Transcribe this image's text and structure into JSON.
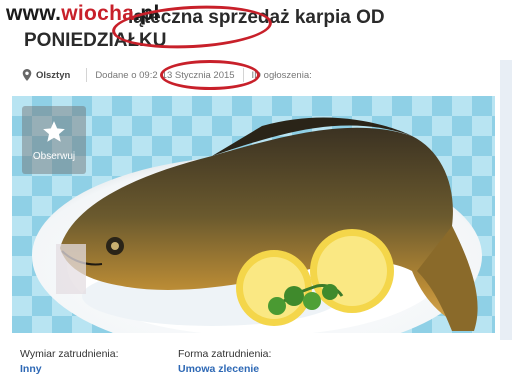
{
  "watermark": {
    "prefix": "www.",
    "brand": "wiocha",
    "suffix": ".pl"
  },
  "ad": {
    "title_hidden": "Świąteczna",
    "title_visible": "iąteczna sprzedaż karpia OD PONIEDZIAŁKU",
    "location": "Olsztyn",
    "added_prefix": "Dodane o 09:2",
    "added_date": "13 Stycznia 2015",
    "ad_id_label": "ID ogłoszenia:",
    "pin_icon": "map-pin-icon"
  },
  "photo": {
    "alt": "Karp na talerzu z cytryną i pietruszką"
  },
  "favorite": {
    "label": "Obserwuj",
    "icon": "star-icon"
  },
  "details": [
    {
      "label": "Wymiar zatrudnienia:",
      "value": "Inny"
    },
    {
      "label": "Forma zatrudnienia:",
      "value": "Umowa zlecenie"
    }
  ],
  "colors": {
    "highlight": "#c8202a",
    "link": "#2d68b5",
    "title": "#2a2a2a"
  }
}
